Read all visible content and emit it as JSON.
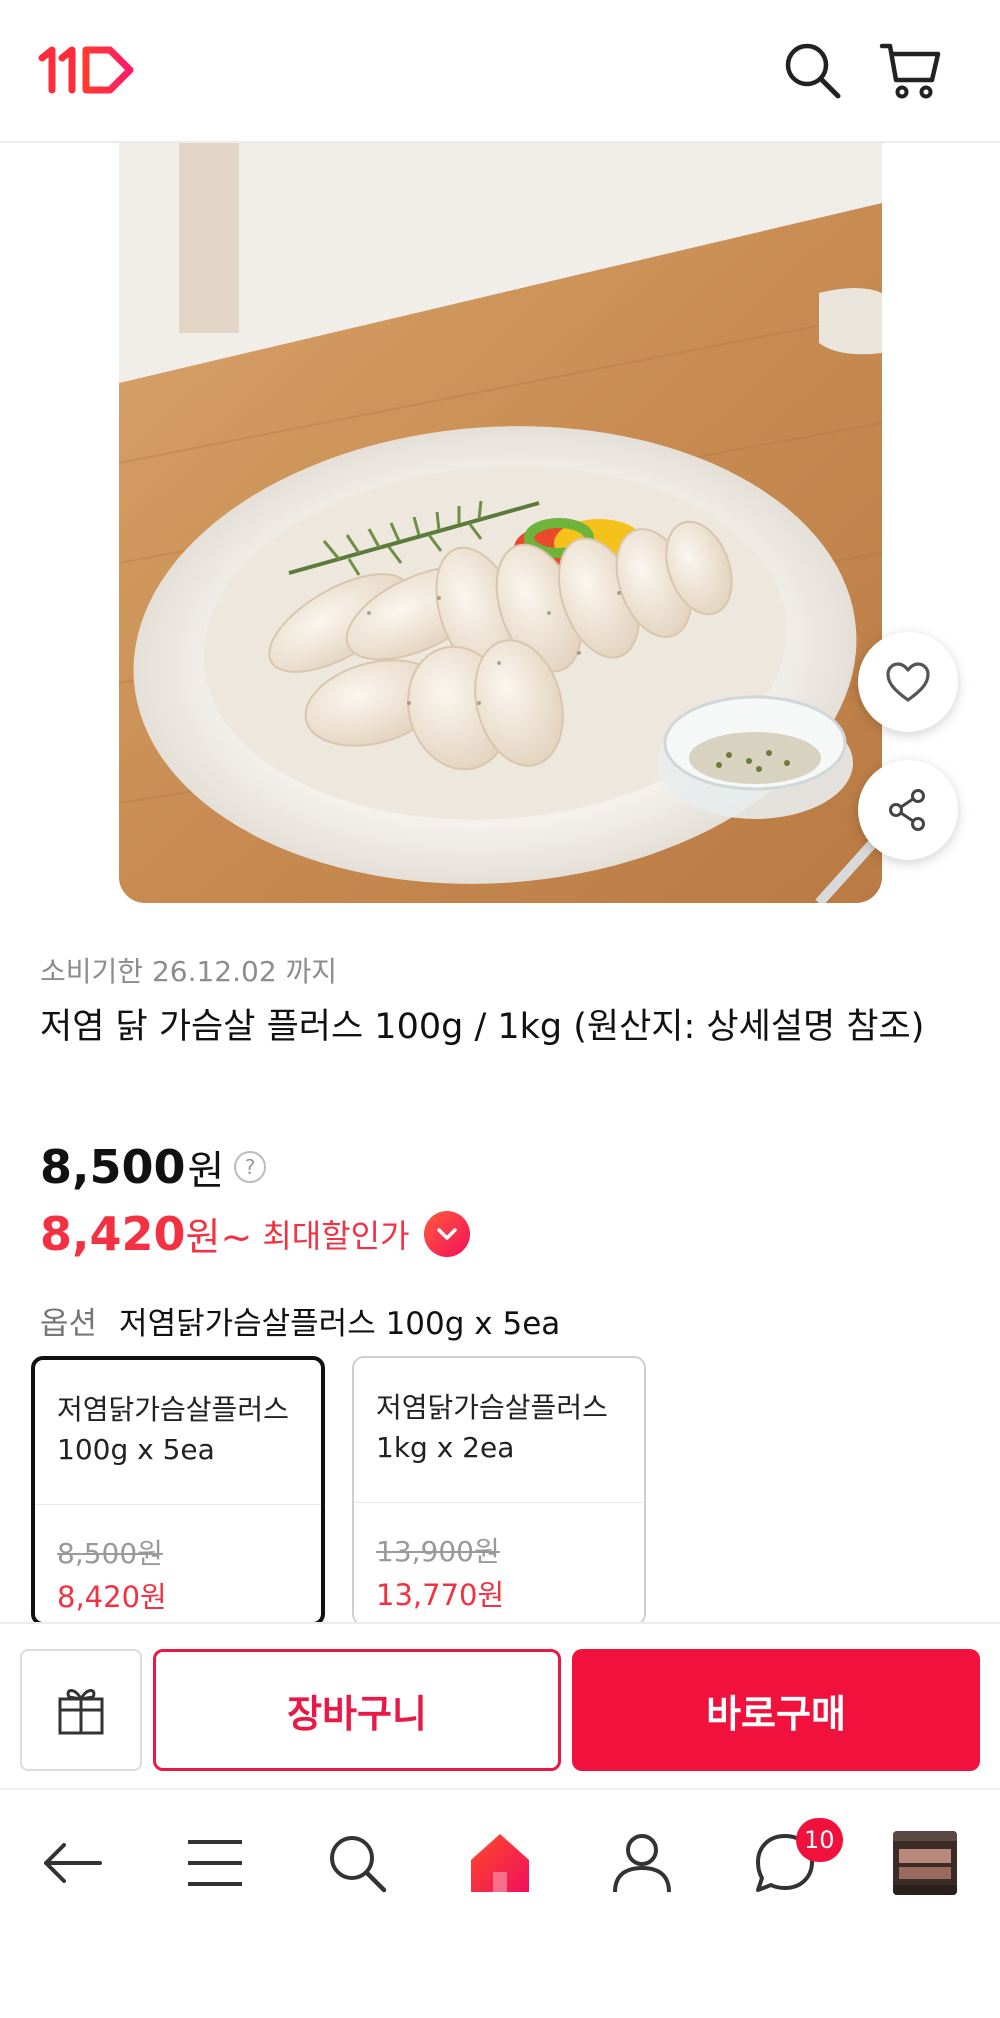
{
  "header": {
    "logo_text": "11",
    "icons": [
      "search-icon",
      "cart-icon"
    ]
  },
  "product": {
    "expiry_text": "소비기한 26.12.02 까지",
    "title": "저염 닭 가슴살 플러스 100g / 1kg (원산지: 상세설명 참조)",
    "price": {
      "original": "8,500",
      "original_unit": "원",
      "discounted": "8,420",
      "discounted_unit": "원~",
      "max_discount_label": "최대할인가"
    }
  },
  "option": {
    "label": "옵션",
    "selected": "저염닭가슴살플러스 100g x 5ea",
    "cards": [
      {
        "name": "저염닭가슴살플러스 100g x 5ea",
        "old_price": "8,500원",
        "new_price": "8,420원",
        "selected": true
      },
      {
        "name": "저염닭가슴살플러스 1kg x 2ea",
        "old_price": "13,900원",
        "new_price": "13,770원",
        "selected": false
      }
    ]
  },
  "actions": {
    "cart_label": "장바구니",
    "buy_label": "바로구매"
  },
  "bottom_nav": {
    "items": [
      "back-icon",
      "menu-icon",
      "search-icon",
      "home-icon",
      "user-icon",
      "chat-icon",
      "recent-product-thumbnail"
    ],
    "chat_badge": "10"
  },
  "colors": {
    "accent": "#f0123c",
    "price_red": "#f43142"
  }
}
